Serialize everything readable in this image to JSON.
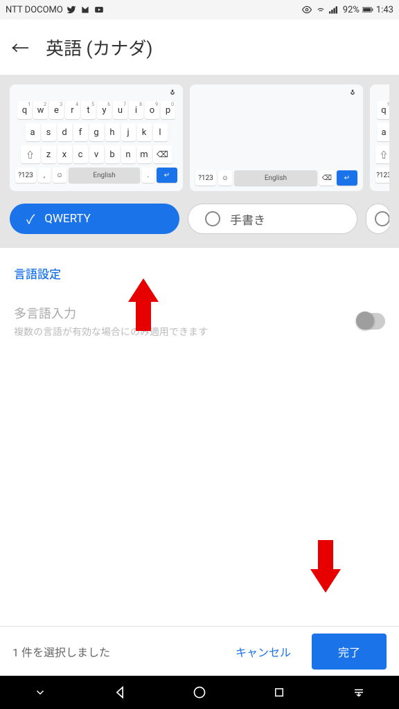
{
  "status_bar": {
    "carrier": "NTT DOCOMO",
    "battery_pct": "92%",
    "time": "1:43"
  },
  "header": {
    "title": "英語 (カナダ)"
  },
  "keyboard_options": [
    {
      "label": "QWERTY",
      "selected": true,
      "space_label": "English"
    },
    {
      "label": "手書き",
      "selected": false,
      "space_label": "English"
    }
  ],
  "settings": {
    "link_label": "言語設定",
    "multi_input_title": "多言語入力",
    "multi_input_desc": "複数の言語が有効な場合にのみ適用できます",
    "multi_input_enabled": false
  },
  "bottom_bar": {
    "selection_text": "1 件を選択しました",
    "cancel_label": "キャンセル",
    "done_label": "完了"
  },
  "qwerty_rows": {
    "row1": [
      "q",
      "w",
      "e",
      "r",
      "t",
      "y",
      "u",
      "i",
      "o",
      "p"
    ],
    "row1_nums": [
      "1",
      "2",
      "3",
      "4",
      "5",
      "6",
      "7",
      "8",
      "9",
      "0"
    ],
    "row2": [
      "a",
      "s",
      "d",
      "f",
      "g",
      "h",
      "j",
      "k",
      "l"
    ],
    "row3": [
      "z",
      "x",
      "c",
      "v",
      "b",
      "n",
      "m"
    ]
  }
}
